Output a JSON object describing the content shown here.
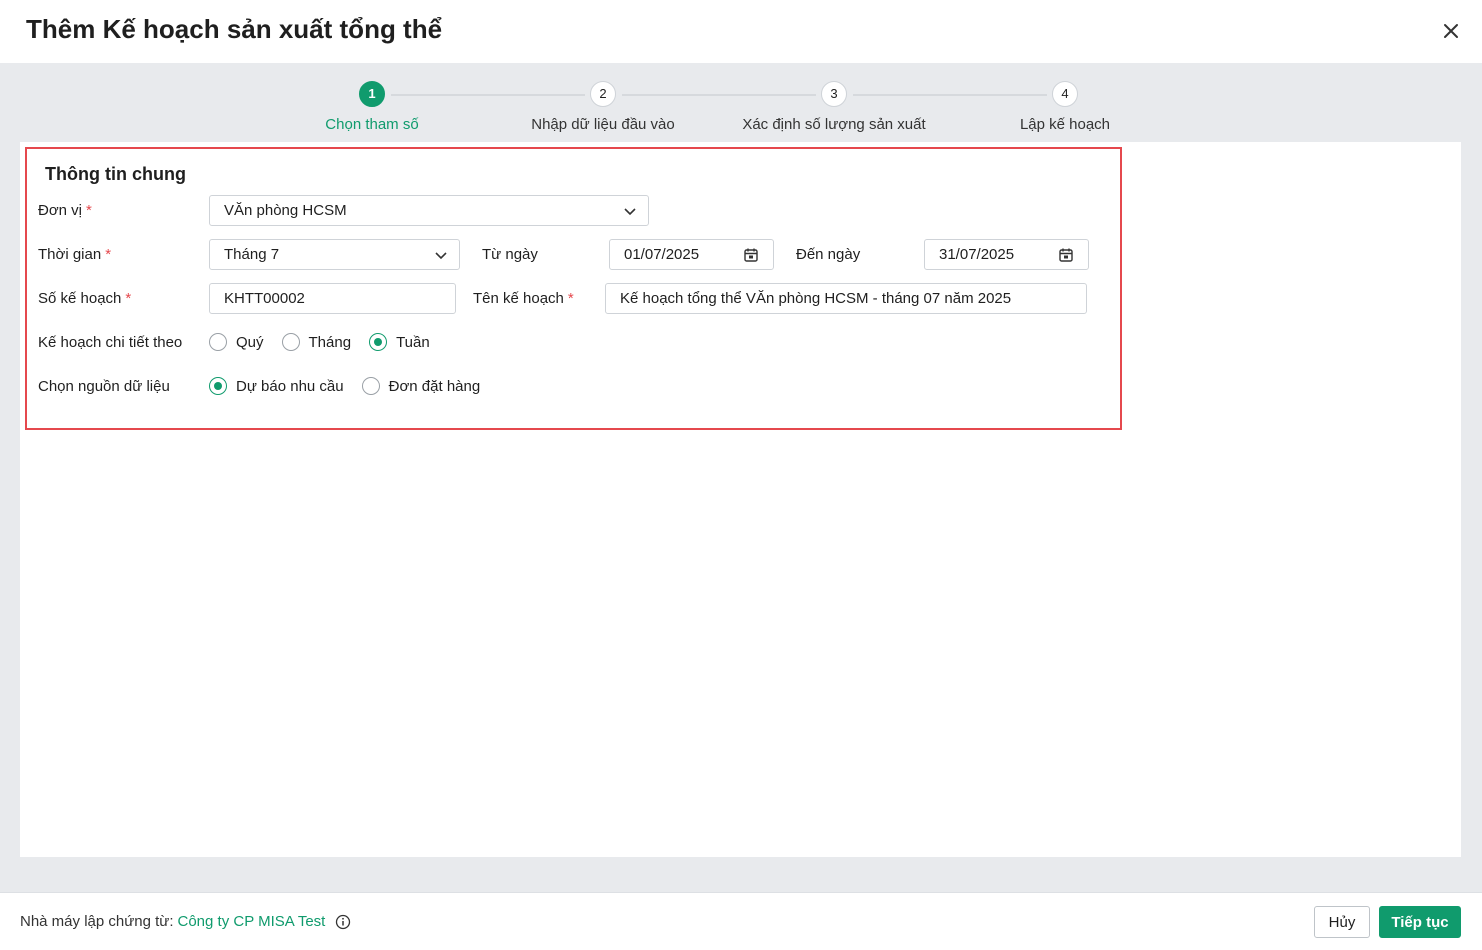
{
  "dialog": {
    "title": "Thêm Kế hoạch sản xuất tổng thể"
  },
  "stepper": {
    "steps": [
      {
        "number": "1",
        "label": "Chọn tham số",
        "active": true
      },
      {
        "number": "2",
        "label": "Nhập dữ liệu đầu vào",
        "active": false
      },
      {
        "number": "3",
        "label": "Xác định số lượng sản xuất",
        "active": false
      },
      {
        "number": "4",
        "label": "Lập kế hoạch",
        "active": false
      }
    ]
  },
  "form": {
    "section_title": "Thông tin chung",
    "required_mark": "*",
    "unit": {
      "label": "Đơn vị",
      "value": "VĂn phòng HCSM"
    },
    "period": {
      "label": "Thời gian",
      "value": "Tháng 7"
    },
    "from_date": {
      "label": "Từ ngày",
      "value": "01/07/2025"
    },
    "to_date": {
      "label": "Đến ngày",
      "value": "31/07/2025"
    },
    "plan_no": {
      "label": "Số kế hoạch",
      "value": "KHTT00002"
    },
    "plan_name": {
      "label": "Tên kế hoạch",
      "value": "Kế hoạch tổng thể VĂn phòng HCSM - tháng 07 năm 2025"
    },
    "detail_by": {
      "label": "Kế hoạch chi tiết theo",
      "options": [
        {
          "label": "Quý",
          "checked": false
        },
        {
          "label": "Tháng",
          "checked": false
        },
        {
          "label": "Tuần",
          "checked": true
        }
      ]
    },
    "data_source": {
      "label": "Chọn nguồn dữ liệu",
      "options": [
        {
          "label": "Dự báo nhu cầu",
          "checked": true
        },
        {
          "label": "Đơn đặt hàng",
          "checked": false
        }
      ]
    }
  },
  "footer": {
    "factory_label": "Nhà máy lập chứng từ:",
    "factory_value": "Công ty CP MISA Test",
    "cancel_label": "Hủy",
    "next_label": "Tiếp tục"
  },
  "colors": {
    "accent": "#109b6d",
    "highlight_border": "#e5484d",
    "required": "#e5484d"
  }
}
